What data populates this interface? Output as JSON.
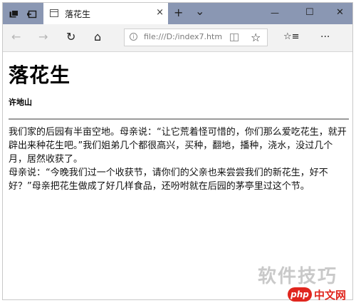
{
  "browser": {
    "tab": {
      "title": "落花生",
      "close": "×"
    },
    "new_tab": "+",
    "tab_list": "⌄",
    "window_controls": {
      "minimize": "—",
      "maximize": "☐",
      "close": "✕"
    },
    "nav": {
      "back": "←",
      "forward": "→",
      "refresh": "↻",
      "home": "⌂",
      "url": "file:///D:/index7.htm",
      "favorite": "☆",
      "favorites_list": "☆≡",
      "more": "···"
    }
  },
  "page": {
    "title": "落花生",
    "author": "许地山",
    "paragraphs": [
      "我们家的后园有半亩空地。母亲说：“让它荒着怪可惜的，你们那么爱吃花生，就开辟出来种花生吧。”我们姐弟几个都很高兴，买种，翻地，播种，浇水，没过几个月，居然收获了。",
      "母亲说：“今晚我们过一个收获节，请你们的父亲也来尝尝我们的新花生，好不好？”母亲把花生做成了好几样食品，还吩咐就在后园的茅亭里过这个节。"
    ]
  },
  "watermarks": {
    "site": "软件技巧",
    "logo": "php",
    "logo_suffix": "中文网"
  }
}
